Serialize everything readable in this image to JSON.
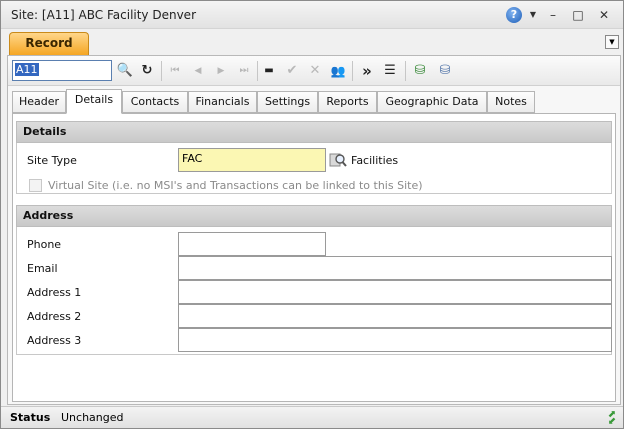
{
  "window": {
    "title": "Site: [A11] ABC Facility Denver",
    "help_glyph": "?",
    "dropdown_glyph": "▼",
    "minimize_glyph": "–",
    "maximize_glyph": "□",
    "close_glyph": "✕"
  },
  "panel": {
    "record_tab": "Record",
    "menu_glyph": "▼"
  },
  "toolbar": {
    "code_value": "A11",
    "icons": {
      "search": "🔍",
      "refresh": "↻",
      "first": "⏮",
      "prev": "◀",
      "next": "▶",
      "last": "⏭",
      "delete": "▬",
      "accept": "✔",
      "cancel": "✕",
      "users": "👥",
      "more": "»",
      "list": "☰",
      "add_db": "⛁",
      "db": "⛁"
    }
  },
  "tabs": [
    "Header",
    "Details",
    "Contacts",
    "Financials",
    "Settings",
    "Reports",
    "Geographic Data",
    "Notes"
  ],
  "active_tab": "Details",
  "details": {
    "heading": "Details",
    "site_type_label": "Site Type",
    "site_type_value": "FAC",
    "site_type_desc": "Facilities",
    "virtual_site_label": "Virtual Site (i.e. no MSI's and Transactions can be linked to this Site)"
  },
  "address": {
    "heading": "Address",
    "phone_label": "Phone",
    "email_label": "Email",
    "address1_label": "Address 1",
    "address2_label": "Address 2",
    "address3_label": "Address 3",
    "phone_value": "",
    "email_value": "",
    "address1_value": "",
    "address2_value": "",
    "address3_value": ""
  },
  "status": {
    "label": "Status",
    "value": "Unchanged"
  },
  "colors": {
    "record_tab": "#f5a623",
    "required_field": "#fbf7b3",
    "section_header": "#d0d0d0"
  }
}
